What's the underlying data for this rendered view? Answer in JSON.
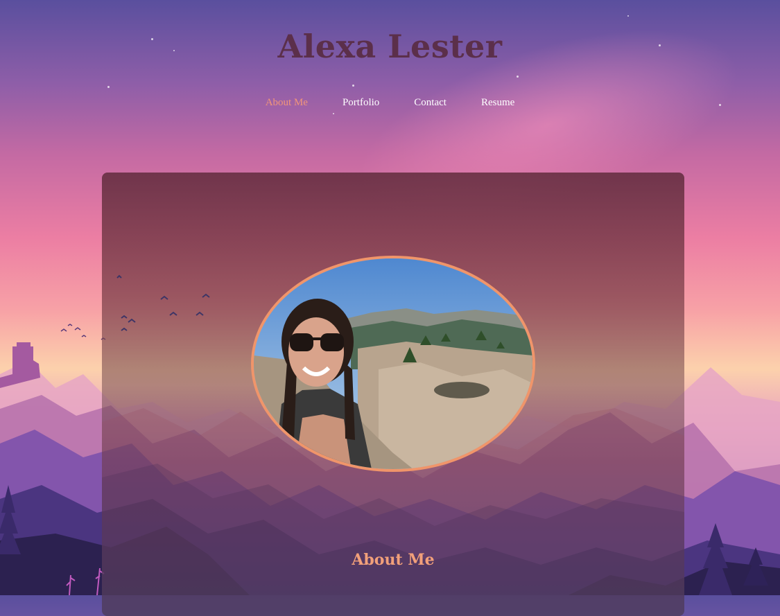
{
  "site": {
    "title": "Alexa Lester"
  },
  "nav": {
    "items": [
      {
        "label": "About Me",
        "active": true
      },
      {
        "label": "Portfolio",
        "active": false
      },
      {
        "label": "Contact",
        "active": false
      },
      {
        "label": "Resume",
        "active": false
      }
    ]
  },
  "main": {
    "section_heading": "About Me",
    "portrait_icon": "profile-photo"
  },
  "colors": {
    "title": "#5b2f4a",
    "nav_active": "#f2957a",
    "nav_text": "#ffffff",
    "portrait_border": "#f0956a",
    "heading": "#f2a07a"
  }
}
